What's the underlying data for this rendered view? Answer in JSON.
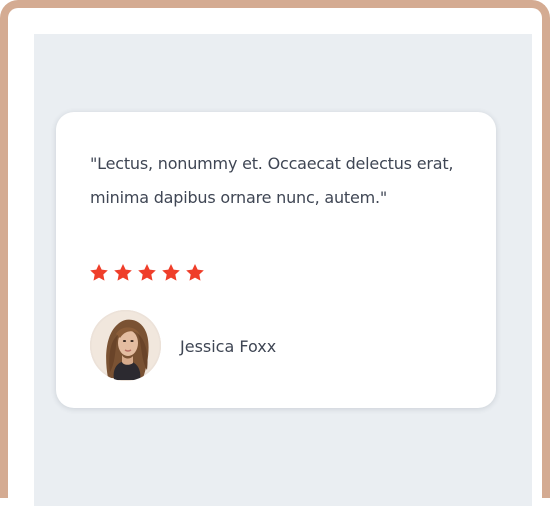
{
  "testimonial": {
    "quote": "\"Lectus, nonummy et. Occaecat delectus erat, minima dapibus ornare nunc, autem.\"",
    "rating": 5,
    "rating_max": 5,
    "author_name": "Jessica Foxx"
  },
  "colors": {
    "frame_border": "#d4ab92",
    "panel_bg": "#eaeef2",
    "star": "#ef3e2a",
    "text": "#3f4654"
  },
  "icons": {
    "star": "star-icon",
    "avatar": "avatar"
  }
}
